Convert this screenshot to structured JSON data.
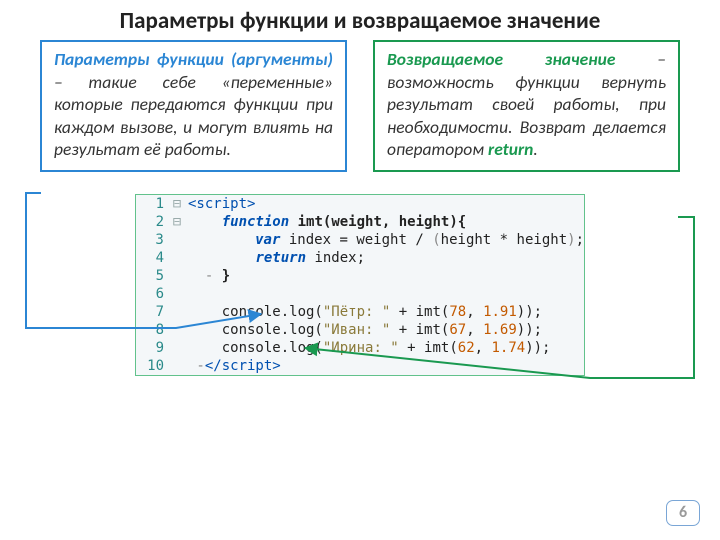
{
  "title": "Параметры функции и возвращаемое значение",
  "left_box": {
    "term": "Параметры функции (аргументы)",
    "rest": " – такие себе «переменные» которые передаются функции при каждом вызове, и могут влиять на результат её работы."
  },
  "right_box": {
    "term": "Возвращаемое значение",
    "rest_pre": " – возможность функции вернуть результат своей работы, при необходимости. Возврат делается оператором ",
    "kw": "return",
    "rest_post": "."
  },
  "page_number": "6",
  "code": {
    "lines": [
      {
        "n": "1",
        "fold": "⊟",
        "html": "<span class='c-tag'>&lt;script&gt;</span>"
      },
      {
        "n": "2",
        "fold": "⊟",
        "html": "    <span class='c-kw'>function</span> <span class='c-id'>imt</span><span class='c-id'>(weight, height){</span>"
      },
      {
        "n": "3",
        "fold": "",
        "html": "        <span class='c-var'>var</span> <span class='c-plain'>index</span> <span class='c-op'>=</span> <span class='c-plain'>weight</span> <span class='c-op'>/</span> <span class='c-par'>(</span><span class='c-plain'>height</span> <span class='c-op'>*</span> <span class='c-plain'>height</span><span class='c-par'>)</span><span class='c-plain'>;</span>"
      },
      {
        "n": "4",
        "fold": "",
        "html": "        <span class='c-ret'>return</span> <span class='c-plain'>index;</span>"
      },
      {
        "n": "5",
        "fold": "",
        "html": "<span class='c-par'>  - </span><span class='c-id'>}</span>"
      },
      {
        "n": "6",
        "fold": "",
        "html": ""
      },
      {
        "n": "7",
        "fold": "",
        "html": "    <span class='c-plain'>console.log(</span><span class='c-str'>\"Пётр: \"</span> <span class='c-op'>+</span> <span class='c-plain'>imt(</span><span class='c-num'>78</span><span class='c-plain'>, </span><span class='c-num'>1.91</span><span class='c-plain'>));</span>"
      },
      {
        "n": "8",
        "fold": "",
        "html": "    <span class='c-plain'>console.log(</span><span class='c-str'>\"Иван: \"</span> <span class='c-op'>+</span> <span class='c-plain'>imt(</span><span class='c-num'>67</span><span class='c-plain'>, </span><span class='c-num'>1.69</span><span class='c-plain'>));</span>"
      },
      {
        "n": "9",
        "fold": "",
        "html": "    <span class='c-plain'>console.log(</span><span class='c-str'>\"Ирина: \"</span> <span class='c-op'>+</span> <span class='c-plain'>imt(</span><span class='c-num'>62</span><span class='c-plain'>, </span><span class='c-num'>1.74</span><span class='c-plain'>));</span>"
      },
      {
        "n": "10",
        "fold": "",
        "html": "<span class='c-par'> -</span><span class='c-tag'>&lt;/script&gt;</span>"
      }
    ]
  }
}
